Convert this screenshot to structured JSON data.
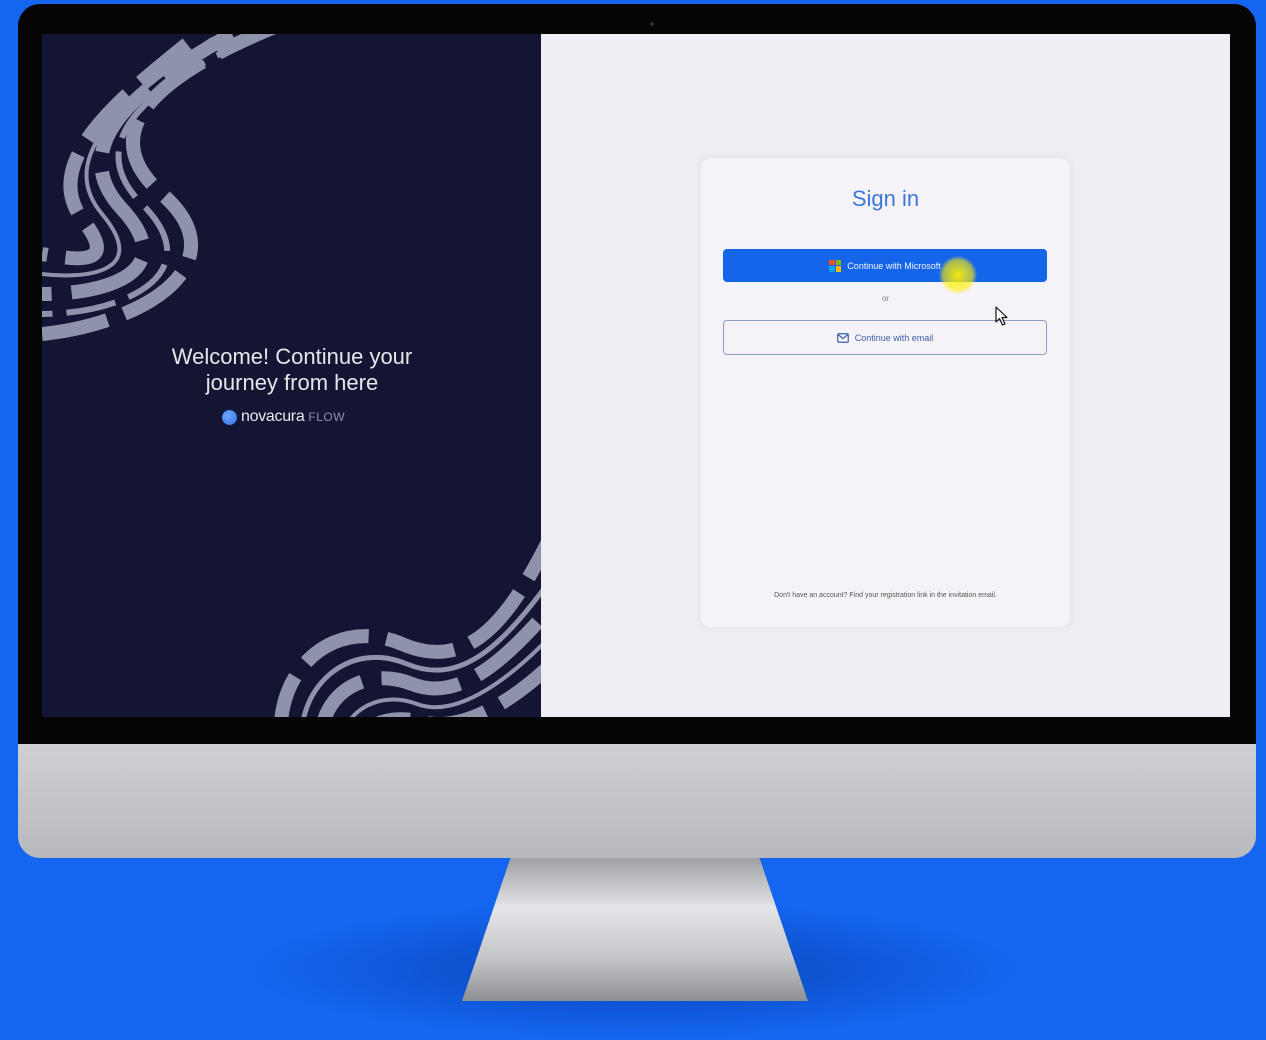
{
  "welcome": {
    "line1": "Welcome! Continue your",
    "line2": "journey from here"
  },
  "brand": {
    "name": "novacura",
    "product": "FLOW"
  },
  "signin": {
    "title": "Sign in",
    "microsoft_label": "Continue with Microsoft",
    "separator": "or",
    "email_label": "Continue with email",
    "footer": "Don't have an account? Find your registration link in the invitation email."
  },
  "colors": {
    "background": "#1466f0",
    "panel_dark": "#141533",
    "accent": "#1565eb",
    "title": "#3b78d8"
  },
  "icons": [
    "microsoft-logo-icon",
    "mail-icon",
    "mouse-pointer-icon"
  ]
}
